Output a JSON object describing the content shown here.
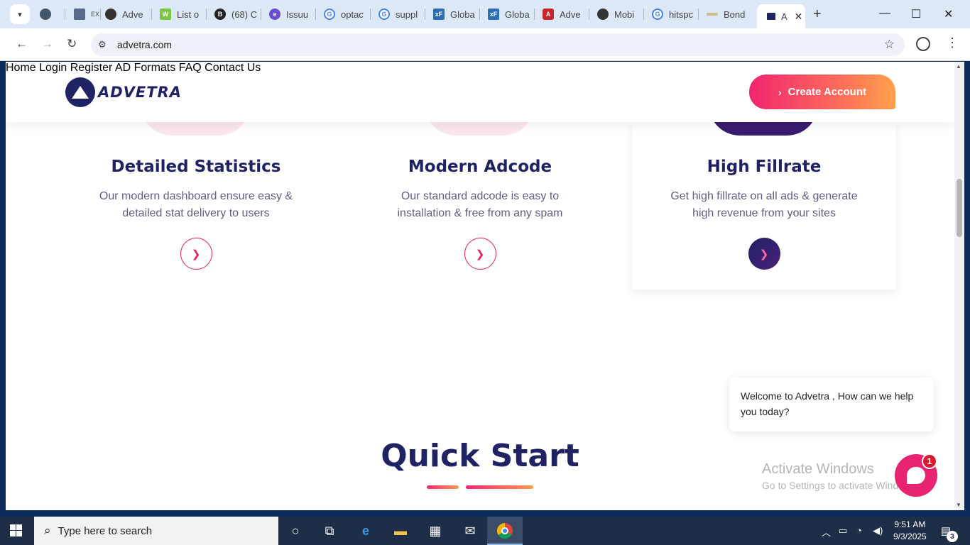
{
  "browser": {
    "tabs": [
      {
        "label": "",
        "favicon": "stack-icon"
      },
      {
        "label": "EX EXCH",
        "favicon": "exch-icon"
      },
      {
        "label": "Adve",
        "favicon": "chatgpt-icon"
      },
      {
        "label": "List o",
        "favicon": "w-icon"
      },
      {
        "label": "(68) C",
        "favicon": "b-icon"
      },
      {
        "label": "Issuu",
        "favicon": "e-icon"
      },
      {
        "label": "optac",
        "favicon": "google-icon"
      },
      {
        "label": "suppl",
        "favicon": "google-icon"
      },
      {
        "label": "Globa",
        "favicon": "xf-icon"
      },
      {
        "label": "Globa",
        "favicon": "xf-icon"
      },
      {
        "label": "Adve",
        "favicon": "adv-red-icon"
      },
      {
        "label": "Mobi",
        "favicon": "mobi-icon"
      },
      {
        "label": "hitspc",
        "favicon": "google-icon"
      },
      {
        "label": "Bond",
        "favicon": "bond-icon"
      },
      {
        "label": "A",
        "favicon": "advetra-icon"
      }
    ],
    "url": "advetra.com"
  },
  "site": {
    "logo_text": "ADVETRA",
    "nav": [
      "Home",
      "Login",
      "Register",
      "AD Formats",
      "FAQ",
      "Contact Us"
    ],
    "cta_label": "Create Account"
  },
  "features": [
    {
      "title": "Detailed Statistics",
      "line1": "Our modern dashboard ensure easy &",
      "line2": "detailed stat delivery to users"
    },
    {
      "title": "Modern Adcode",
      "line1": "Our standard adcode is easy to",
      "line2": "installation & free from any spam"
    },
    {
      "title": "High Fillrate",
      "line1": "Get high fillrate on all ads & generate",
      "line2": "high revenue from your sites"
    }
  ],
  "quick_start": "Quick Start",
  "chat": {
    "message": "Welcome to Advetra , How can we help you today?",
    "badge": "1"
  },
  "watermark": {
    "title": "Activate Windows",
    "subtitle": "Go to Settings to activate Windows."
  },
  "taskbar": {
    "search_placeholder": "Type here to search",
    "time": "9:51 AM",
    "date": "9/3/2025",
    "notifications": "3"
  },
  "colors": {
    "brand": "#1f2364",
    "accent": "#e8236f",
    "cta_gradient_end": "#ffa14b"
  }
}
